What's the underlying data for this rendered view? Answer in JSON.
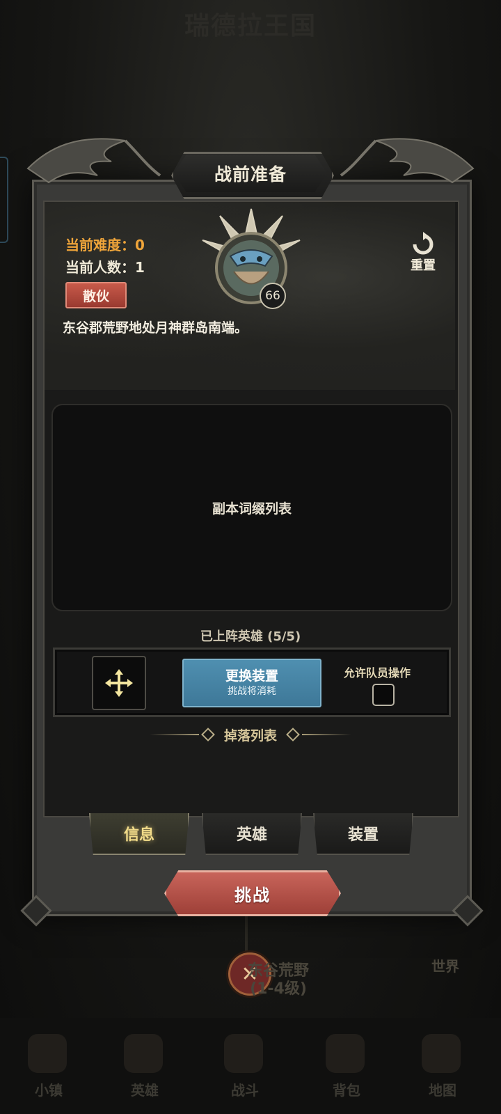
{
  "background": {
    "title": "瑞德拉王国",
    "map_node": {
      "name": "东谷荒野",
      "level_range": "(1-4级)"
    },
    "world_label": "世界",
    "bottom_nav": [
      "小镇",
      "英雄",
      "战斗",
      "背包",
      "地图"
    ]
  },
  "modal": {
    "title": "战前准备",
    "difficulty": "当前难度：0",
    "member_count": "当前人数：1",
    "solo_badge": "散伙",
    "description": "东谷郡荒野地处月神群岛南端。",
    "boss_level": "66",
    "reset_label": "重置",
    "affix_list_label": "副本词缀列表",
    "deployed_heroes": "已上阵英雄 (5/5)",
    "swap_gear": {
      "title": "更换装置",
      "subtitle": "挑战将消耗"
    },
    "allow_member_action": "允许队员操作",
    "allow_member_checked": false,
    "drops_title": "掉落列表",
    "tabs": [
      {
        "label": "信息",
        "active": true
      },
      {
        "label": "英雄",
        "active": false
      },
      {
        "label": "装置",
        "active": false
      }
    ],
    "challenge_label": "挑战"
  },
  "colors": {
    "accent_orange": "#f0a53a",
    "badge_red": "#c85a4a",
    "swap_blue": "#4f8fb0",
    "tab_active_gold": "#f2dc8a",
    "challenge_red": "#b8524a"
  }
}
